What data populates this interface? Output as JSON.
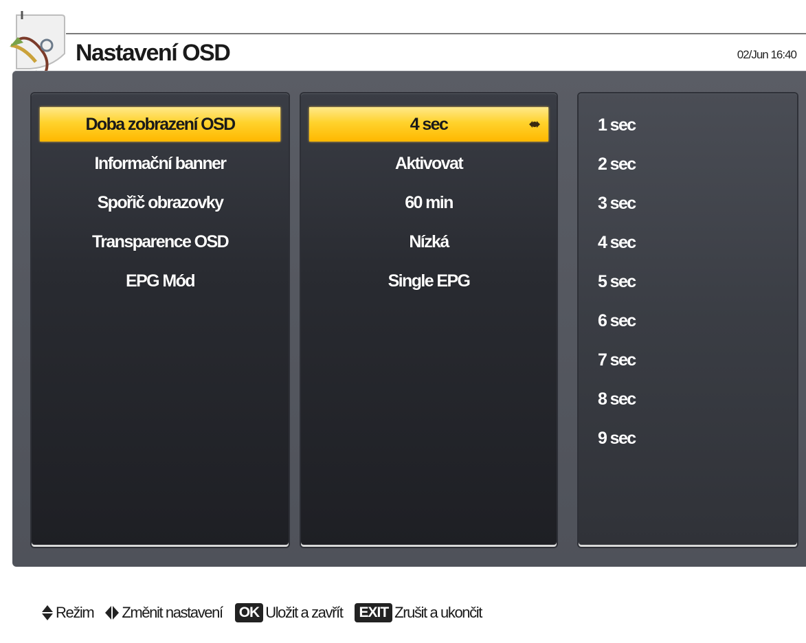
{
  "header": {
    "title": "Nastavení OSD",
    "datetime": "02/Jun 16:40"
  },
  "settings": {
    "labels": [
      "Doba zobrazení OSD",
      "Informační banner",
      "Spořič obrazovky",
      "Transparence OSD",
      "EPG Mód"
    ],
    "values": [
      "4 sec",
      "Aktivovat",
      "60 min",
      "Nízká",
      "Single EPG"
    ],
    "selected_index": 0
  },
  "options": [
    "1 sec",
    "2 sec",
    "3 sec",
    "4 sec",
    "5 sec",
    "6 sec",
    "7 sec",
    "8 sec",
    "9 sec"
  ],
  "footer": {
    "mode_label": "Režim",
    "change_label": "Změnit nastavení",
    "ok_key": "OK",
    "ok_label": "Uložit a zavřít",
    "exit_key": "EXIT",
    "exit_label": "Zrušit a ukončit"
  },
  "colors": {
    "highlight": "#ffd22c",
    "frame": "#55585f",
    "panel": "#292b31"
  },
  "icons": {
    "logo": "settings-tools-icon",
    "selected_value": "left-right-arrows-icon",
    "mode": "up-down-arrows-icon",
    "change": "left-right-arrows-icon"
  }
}
